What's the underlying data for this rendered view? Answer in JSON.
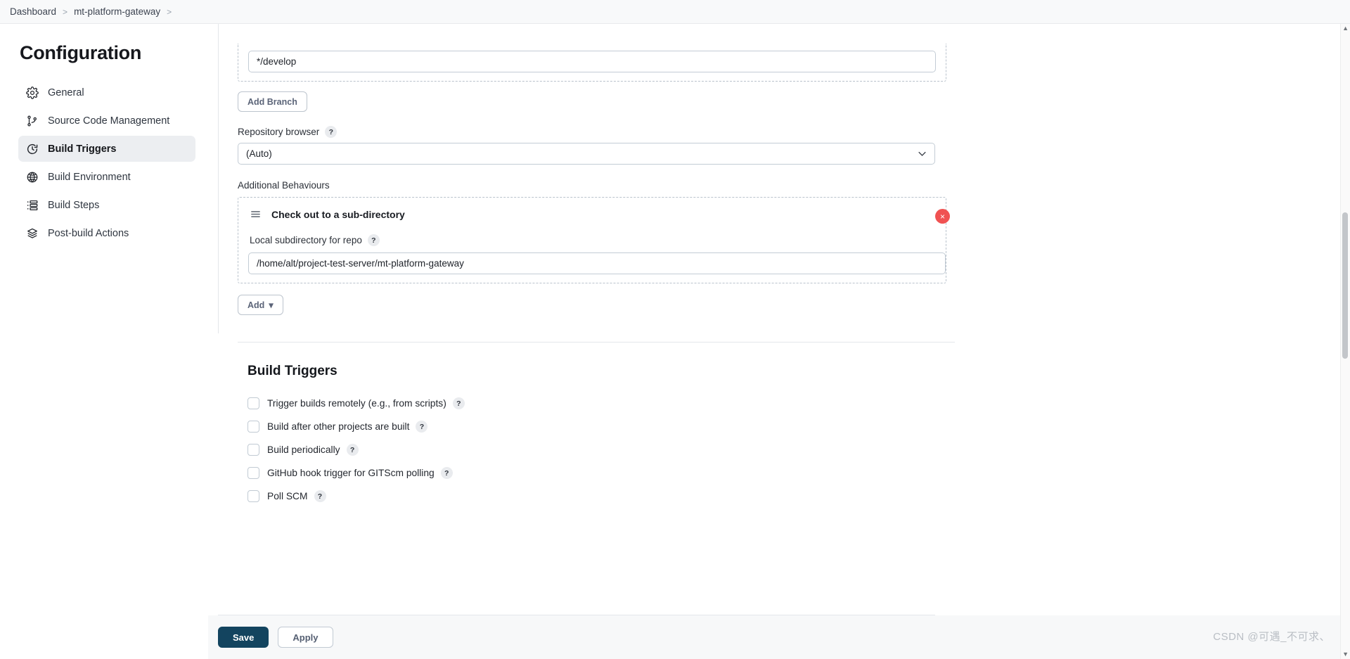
{
  "breadcrumb": {
    "items": [
      "Dashboard",
      "mt-platform-gateway"
    ],
    "separator": ">"
  },
  "sidebar": {
    "title": "Configuration",
    "items": [
      {
        "label": "General",
        "icon": "gear-icon",
        "active": false
      },
      {
        "label": "Source Code Management",
        "icon": "git-branch-icon",
        "active": false
      },
      {
        "label": "Build Triggers",
        "icon": "clock-icon",
        "active": true
      },
      {
        "label": "Build Environment",
        "icon": "globe-icon",
        "active": false
      },
      {
        "label": "Build Steps",
        "icon": "list-steps-icon",
        "active": false
      },
      {
        "label": "Post-build Actions",
        "icon": "package-icon",
        "active": false
      }
    ]
  },
  "scm": {
    "branch_value": "*/develop",
    "add_branch_label": "Add Branch",
    "repository_browser": {
      "label": "Repository browser",
      "help": "?",
      "selected": "(Auto)",
      "options": [
        "(Auto)"
      ]
    },
    "additional_behaviours": {
      "label": "Additional Behaviours",
      "panel": {
        "title": "Check out to a sub-directory",
        "drag_handle": "drag-handle-icon",
        "delete": "×",
        "field_label": "Local subdirectory for repo",
        "field_help": "?",
        "field_value": "/home/alt/project-test-server/mt-platform-gateway"
      },
      "add_label": "Add",
      "add_caret": "▾"
    }
  },
  "build_triggers": {
    "title": "Build Triggers",
    "items": [
      {
        "label": "Trigger builds remotely (e.g., from scripts)",
        "help": "?",
        "checked": false
      },
      {
        "label": "Build after other projects are built",
        "help": "?",
        "checked": false
      },
      {
        "label": "Build periodically",
        "help": "?",
        "checked": false
      },
      {
        "label": "GitHub hook trigger for GITScm polling",
        "help": "?",
        "checked": false
      },
      {
        "label": "Poll SCM",
        "help": "?",
        "checked": false
      }
    ]
  },
  "footer": {
    "save_label": "Save",
    "apply_label": "Apply"
  },
  "watermark": "CSDN @可遇_不可求、",
  "colors": {
    "accent": "#13445f",
    "danger": "#f05252",
    "active_nav_bg": "#eceef1",
    "border": "#c3ccd5"
  }
}
